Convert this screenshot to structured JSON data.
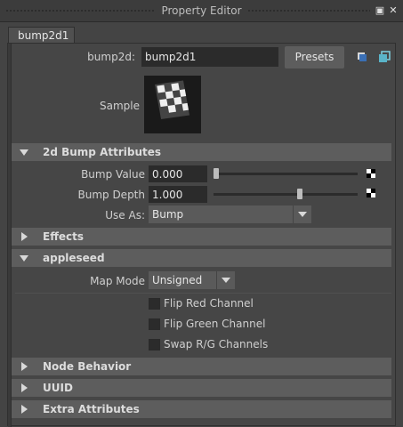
{
  "window": {
    "title": "Property Editor"
  },
  "tab": {
    "label": "bump2d1"
  },
  "node": {
    "type_label": "bump2d:",
    "name": "bump2d1",
    "presets_label": "Presets"
  },
  "sample": {
    "label": "Sample"
  },
  "sections": {
    "bump_attrs": "2d Bump Attributes",
    "effects": "Effects",
    "appleseed": "appleseed",
    "node_behavior": "Node Behavior",
    "uuid": "UUID",
    "extra": "Extra Attributes"
  },
  "bump": {
    "value_label": "Bump Value",
    "value": "0.000",
    "value_slider": 0.0,
    "depth_label": "Bump Depth",
    "depth": "1.000",
    "depth_slider": 0.6,
    "use_as_label": "Use As:",
    "use_as": "Bump"
  },
  "appleseed": {
    "map_mode_label": "Map Mode",
    "map_mode": "Unsigned",
    "flip_red": "Flip Red Channel",
    "flip_green": "Flip Green Channel",
    "swap_rg": "Swap R/G Channels"
  },
  "icons": {
    "float_window": "float-window-icon",
    "close": "close-icon",
    "copy_tab": "copy-tab-icon",
    "map_button": "map-icon"
  }
}
